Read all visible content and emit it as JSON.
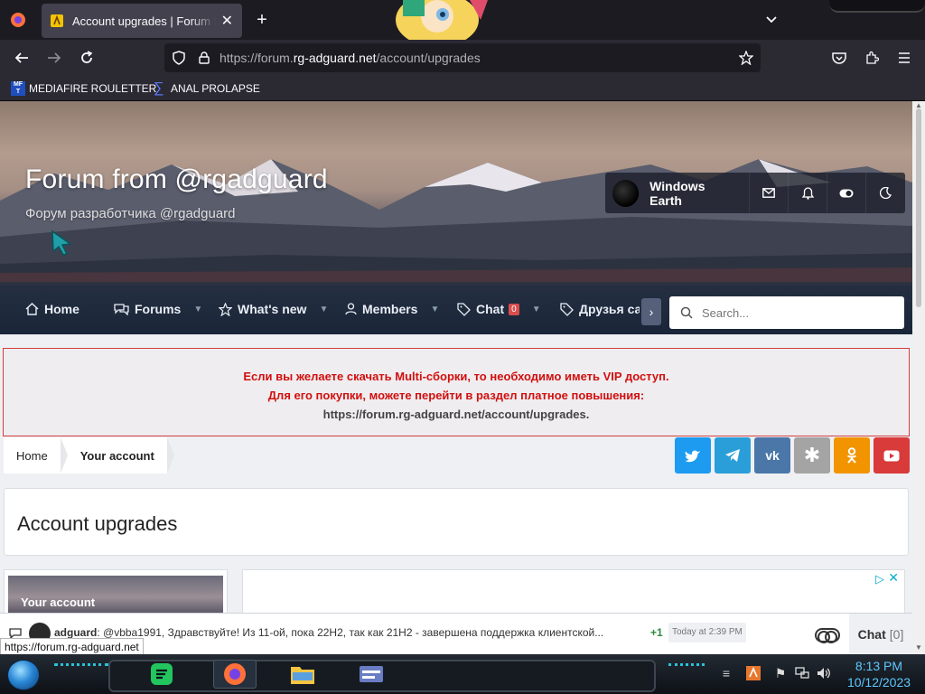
{
  "browser": {
    "tab_title": "Account upgrades | Forum from @rgadguard",
    "url_prefix": "https://forum.",
    "url_domain": "rg-adguard.net",
    "url_path": "/account/upgrades",
    "bookmarks": [
      {
        "label": "MEDIAFIRE ROULETTER",
        "icon": "mediafire-icon"
      },
      {
        "label": "ANAL PROLAPSE",
        "icon": "sigma-icon"
      }
    ]
  },
  "forum": {
    "title": "Forum from @rgadguard",
    "subtitle": "Форум разработчика @rgadguard",
    "username": "Windows Earth",
    "nav": {
      "home": "Home",
      "forums": "Forums",
      "whats_new": "What's new",
      "members": "Members",
      "chat": "Chat",
      "chat_count": "0",
      "friends": "Друзья сай"
    },
    "search_placeholder": "Search...",
    "notice": {
      "line1": "Если вы желаете скачать Multi-сборки, то необходимо иметь VIP доступ.",
      "line2": "Для его покупки, можете перейти в раздел платное повышения:",
      "line3": "https://forum.rg-adguard.net/account/upgrades."
    },
    "breadcrumbs": [
      "Home",
      "Your account"
    ],
    "social": [
      {
        "name": "twitter",
        "glyph": "t",
        "color": "#1d9bf0"
      },
      {
        "name": "telegram",
        "glyph": "➤",
        "color": "#2a9ed8"
      },
      {
        "name": "vk",
        "glyph": "vk",
        "color": "#4a76a8"
      },
      {
        "name": "livejournal",
        "glyph": "✱",
        "color": "#a4a4a4"
      },
      {
        "name": "odnoklassniki",
        "glyph": "ok",
        "color": "#f29400"
      },
      {
        "name": "youtube",
        "glyph": "▶",
        "color": "#d93a3a"
      }
    ],
    "page_title": "Account upgrades",
    "sidebar_heading": "Your account"
  },
  "chat": {
    "author": "adguard",
    "message": "@vbba1991, Здравствуйте! Из 11-ой, пока 22H2, так как 21H2 - завершена поддержка клиентской...",
    "plus": "+1",
    "time": "Today at 2:39 PM",
    "label": "Chat",
    "count": "[0]"
  },
  "status_url": "https://forum.rg-adguard.net",
  "taskbar": {
    "time": "8:13 PM",
    "date": "10/12/2023"
  }
}
